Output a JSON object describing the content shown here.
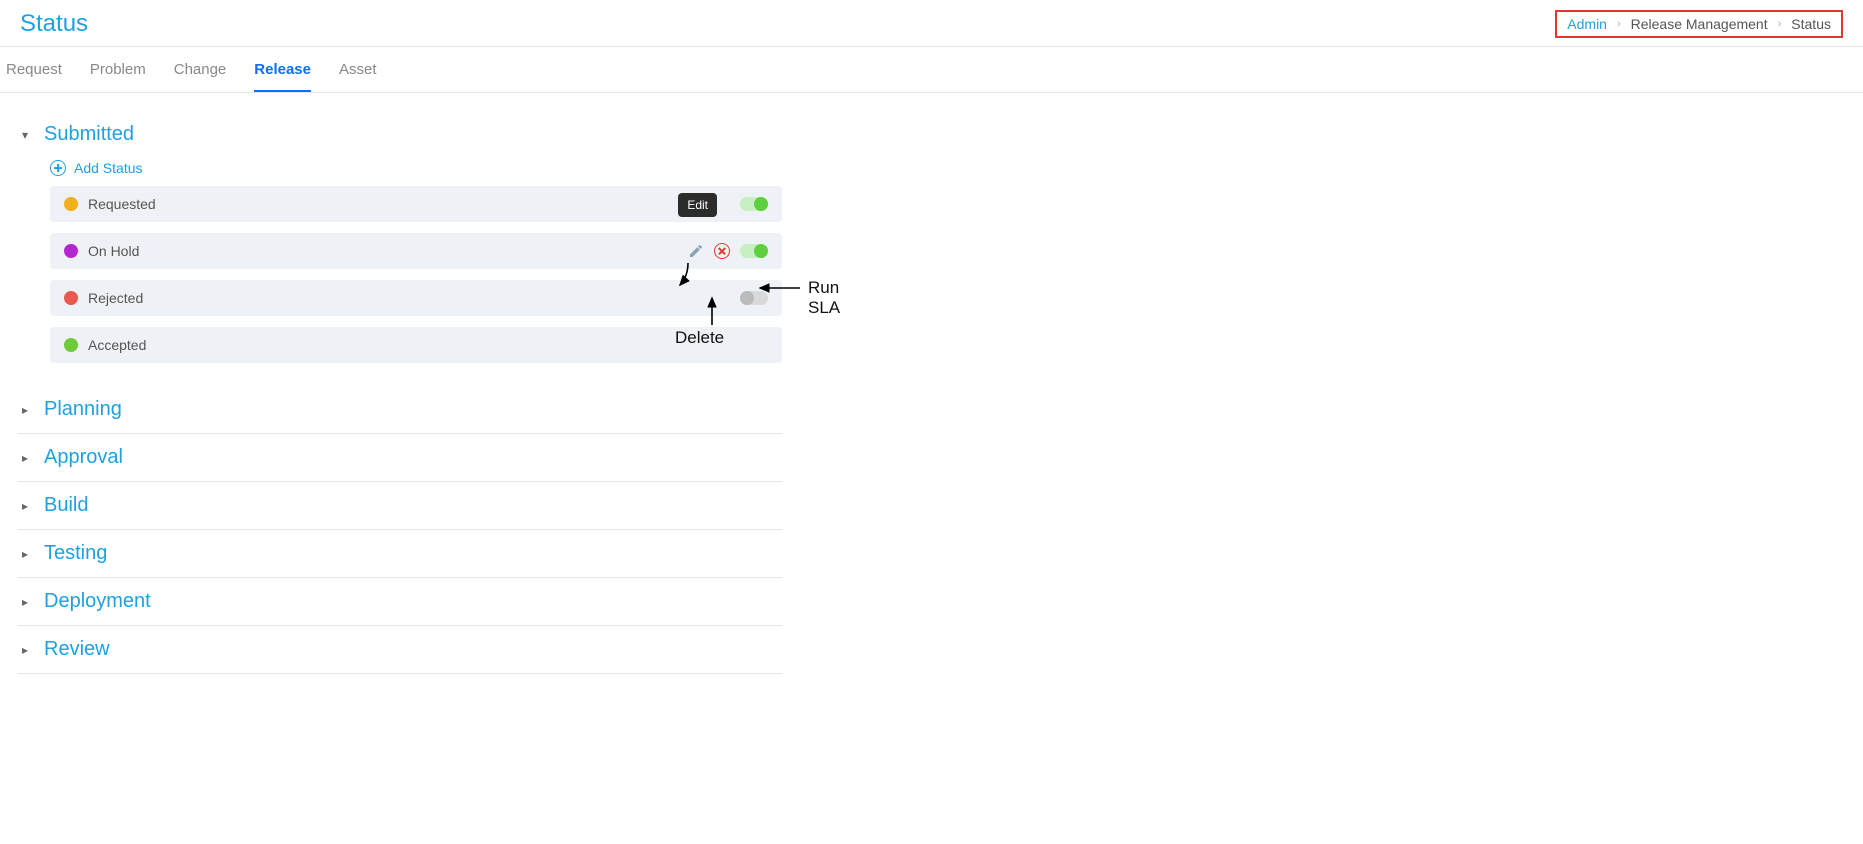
{
  "header": {
    "title": "Status",
    "breadcrumb": [
      {
        "label": "Admin",
        "link": true
      },
      {
        "label": "Release Management",
        "link": false
      },
      {
        "label": "Status",
        "link": false
      }
    ]
  },
  "tabs": [
    {
      "label": "Request",
      "active": false
    },
    {
      "label": "Problem",
      "active": false
    },
    {
      "label": "Change",
      "active": false
    },
    {
      "label": "Release",
      "active": true
    },
    {
      "label": "Asset",
      "active": false
    }
  ],
  "sections": {
    "submitted": {
      "title": "Submitted",
      "add_label": "Add Status",
      "items": [
        {
          "name": "Requested",
          "color": "#f2b01e",
          "toggle_on": true,
          "show_actions": false
        },
        {
          "name": "On Hold",
          "color": "#b326d0",
          "toggle_on": true,
          "show_actions": true
        },
        {
          "name": "Rejected",
          "color": "#e85a4f",
          "toggle_on": false,
          "show_actions": false,
          "toggle_disabled": true
        },
        {
          "name": "Accepted",
          "color": "#6ecb3a",
          "toggle_on": false,
          "show_actions": false,
          "no_toggle": true
        }
      ]
    },
    "collapsed": [
      {
        "title": "Planning"
      },
      {
        "title": "Approval"
      },
      {
        "title": "Build"
      },
      {
        "title": "Testing"
      },
      {
        "title": "Deployment"
      },
      {
        "title": "Review"
      }
    ]
  },
  "annotations": {
    "edit_tooltip": "Edit",
    "run_sla": "Run SLA",
    "delete": "Delete"
  }
}
